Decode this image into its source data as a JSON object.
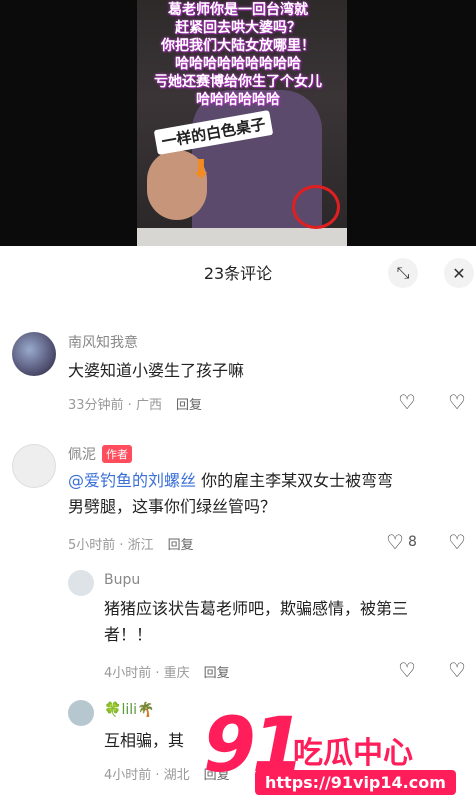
{
  "video": {
    "caption_lines": [
      "葛老师你是一回台湾就",
      "赶紧回去哄大婆吗？",
      "你把我们大陆女放哪里！",
      "哈哈哈哈哈哈哈哈哈",
      "亏她还赛博给你生了个女儿",
      "哈哈哈哈哈哈"
    ],
    "tag": "一样的白色桌子"
  },
  "header": {
    "title": "23条评论",
    "collapse_icon": "collapse-icon",
    "close_icon": "close-icon"
  },
  "comments": [
    {
      "name": "南风知我意",
      "text": "大婆知道小婆生了孩子嘛",
      "time": "33分钟前 · 广西",
      "reply": "回复",
      "likes": ""
    },
    {
      "name": "佩泥",
      "badge": "作者",
      "mention": "@爱钓鱼的刘螺丝",
      "text_line1": "你的雇主李某双女士被弯弯",
      "text_line2": "男劈腿，这事你们绿丝管吗？",
      "time": "5小时前 · 浙江",
      "reply": "回复",
      "likes": "8"
    },
    {
      "name": "Bupu",
      "text_line1": "猪猪应该状告葛老师吧，欺骗感情，被第三",
      "text_line2": "者！！",
      "time": "4小时前 · 重庆",
      "reply": "回复"
    },
    {
      "name": "lili",
      "text": "互相骗，其",
      "time": "4小时前 · 湖北",
      "reply": "回复"
    }
  ],
  "watermark": {
    "brand_num": "91",
    "brand_cn": "吃瓜中心",
    "url": "https://91vip14.com"
  },
  "colors": {
    "accent": "#ff1d5a",
    "mention": "#3a6fd8",
    "badge": "#ff4d5e"
  }
}
